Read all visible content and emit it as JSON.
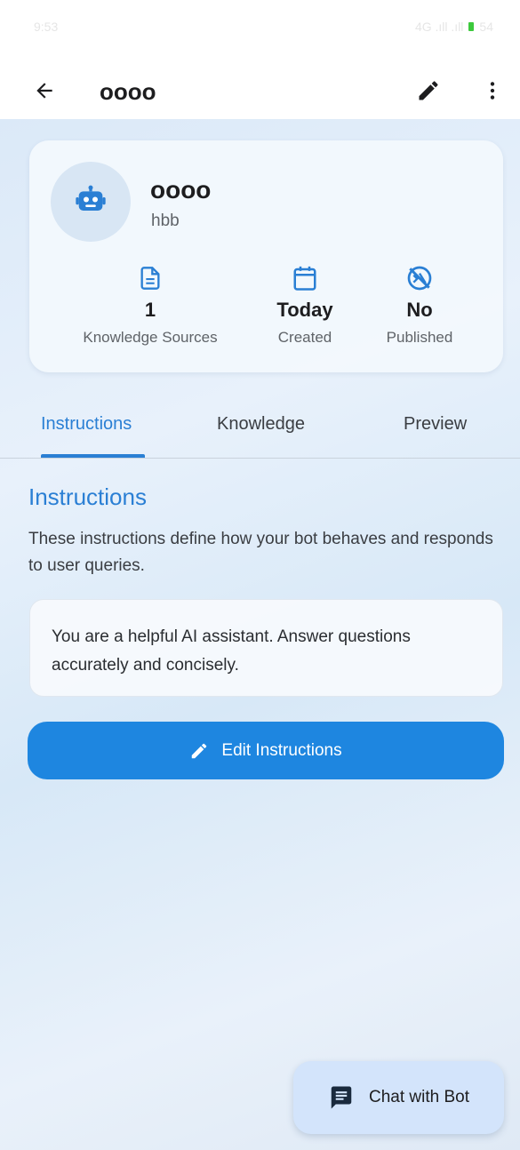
{
  "status_bar": {
    "time": "9:53",
    "right_text": "4G .ıll .ıll",
    "battery": "54"
  },
  "app_bar": {
    "title": "oooo",
    "back_icon": "arrow-left-icon",
    "edit_icon": "pencil-icon",
    "more_icon": "more-vertical-icon"
  },
  "bot": {
    "name": "oooo",
    "description": "hbb",
    "avatar_icon": "robot-icon",
    "stats": [
      {
        "icon": "document-icon",
        "value": "1",
        "label": "Knowledge Sources"
      },
      {
        "icon": "calendar-icon",
        "value": "Today",
        "label": "Created"
      },
      {
        "icon": "unpublished-icon",
        "value": "No",
        "label": "Published"
      }
    ]
  },
  "tabs": {
    "items": [
      "Instructions",
      "Knowledge",
      "Preview"
    ],
    "active": "Instructions"
  },
  "instructions": {
    "title": "Instructions",
    "description": "These instructions define how your bot behaves and responds to user queries.",
    "text": "You are a helpful AI assistant. Answer questions accurately and concisely.",
    "edit_button_label": "Edit Instructions"
  },
  "fab": {
    "label": "Chat with Bot",
    "icon": "chat-icon"
  },
  "colors": {
    "accent": "#2a7fd4",
    "button": "#1e86e0",
    "fab_bg": "#d3e4fb"
  }
}
